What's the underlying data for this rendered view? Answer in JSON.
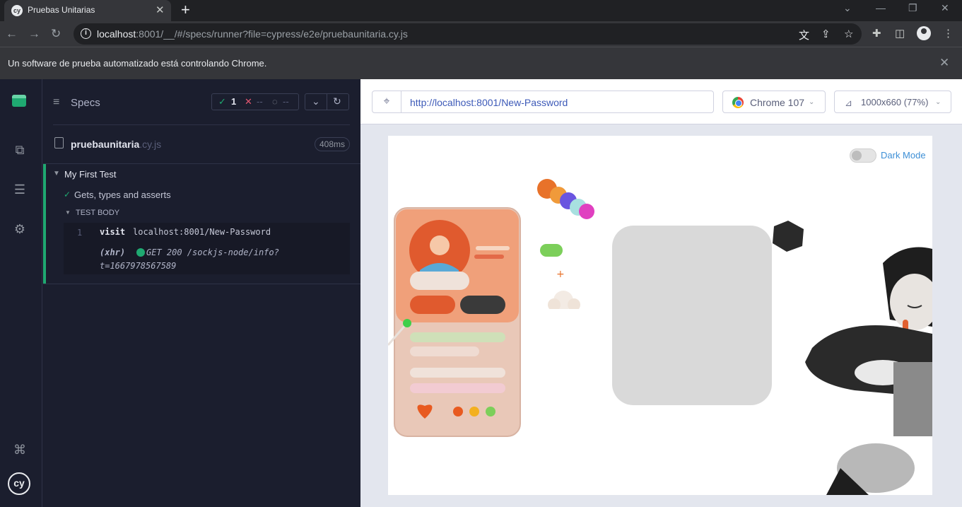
{
  "browser": {
    "tab_title": "Pruebas Unitarias",
    "tab_favicon": "cy",
    "address_host": "localhost",
    "address_rest": ":8001/__/#/specs/runner?file=cypress/e2e/pruebaunitaria.cy.js",
    "infobar_text": "Un software de prueba automatizado está controlando Chrome."
  },
  "reporter": {
    "specs_label": "Specs",
    "passed_count": "1",
    "failed_count": "--",
    "pending_count": "--",
    "file_name": "pruebaunitaria",
    "file_ext": ".cy.js",
    "duration": "408ms",
    "suite_title": "My First Test",
    "test_title": "Gets, types and asserts",
    "test_body_label": "TEST BODY",
    "command": {
      "number": "1",
      "name": "visit",
      "message": "localhost:8001/New-Password"
    },
    "xhr": {
      "name": "(xhr)",
      "message_line1": "GET 200 /sockjs-node/info?",
      "message_line2": "t=1667978567589"
    }
  },
  "aut": {
    "url": "http://localhost:8001/New-Password",
    "browser_label": "Chrome 107",
    "viewport_label": "1000x660 (77%)",
    "dark_mode_label": "Dark Mode"
  },
  "colors": {
    "pass": "#1fa971",
    "fail": "#e45770",
    "link": "#3d5ab8"
  }
}
